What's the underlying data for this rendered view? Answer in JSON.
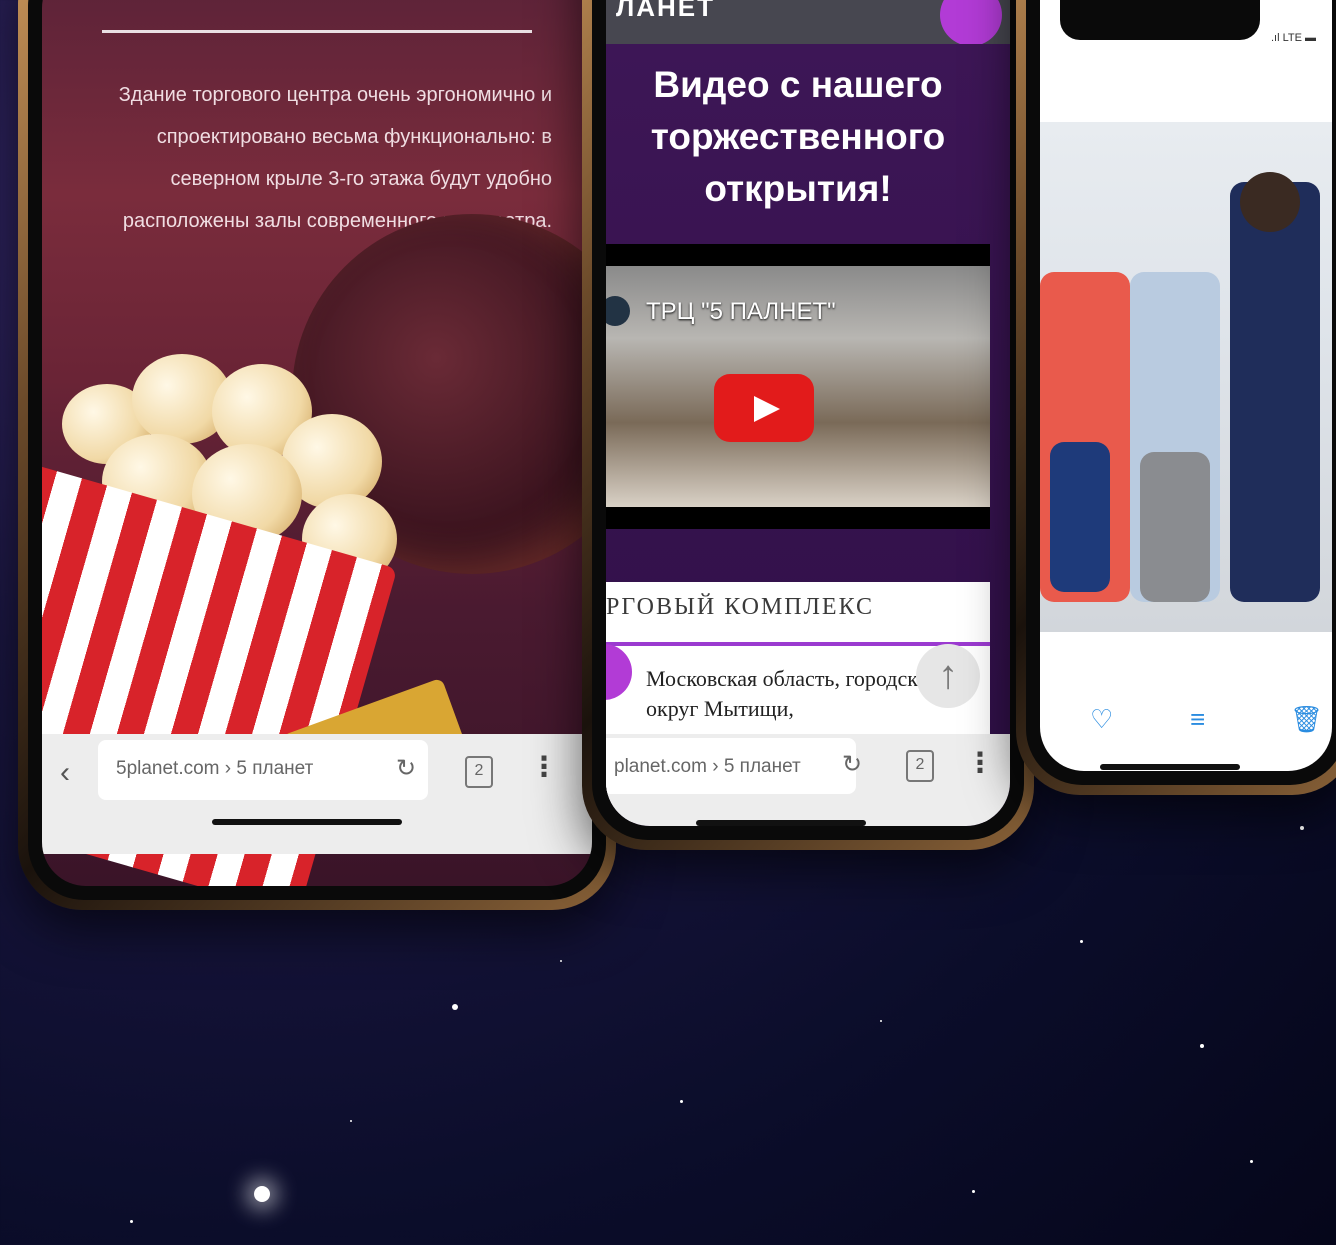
{
  "phone1": {
    "description_text": "Здание торгового центра очень эргономично и спроектировано весьма функционально: в северном крыле 3-го этажа будут удобно расположены залы современного кинотеатра.",
    "url": "5planet.com › 5 планет",
    "tab_count": "2"
  },
  "phone2": {
    "logo": "ЛАНЕТ",
    "title": "Видео с нашего торжественного открытия!",
    "video_title": "ТРЦ \"5 ПАЛНЕТ\"",
    "section_header": "РГОВЫЙ КОМПЛЕКС",
    "address": "Московская область, городской округ Мытищи,",
    "url": "planet.com › 5 планет",
    "tab_count": "2"
  },
  "phone3": {
    "status": ".ıl LTE ▬"
  },
  "icons": {
    "back": "chevron-left-icon",
    "reload": "reload-icon",
    "tabs": "tabs-icon",
    "menu": "kebab-menu-icon",
    "play": "play-icon",
    "to_top": "arrow-up-icon",
    "like": "heart-icon",
    "adjust": "sliders-icon",
    "delete": "trash-icon"
  },
  "colors": {
    "accent_purple": "#b23bd6",
    "youtube_red": "#e21b1b",
    "ios_blue": "#2a8ce0"
  }
}
